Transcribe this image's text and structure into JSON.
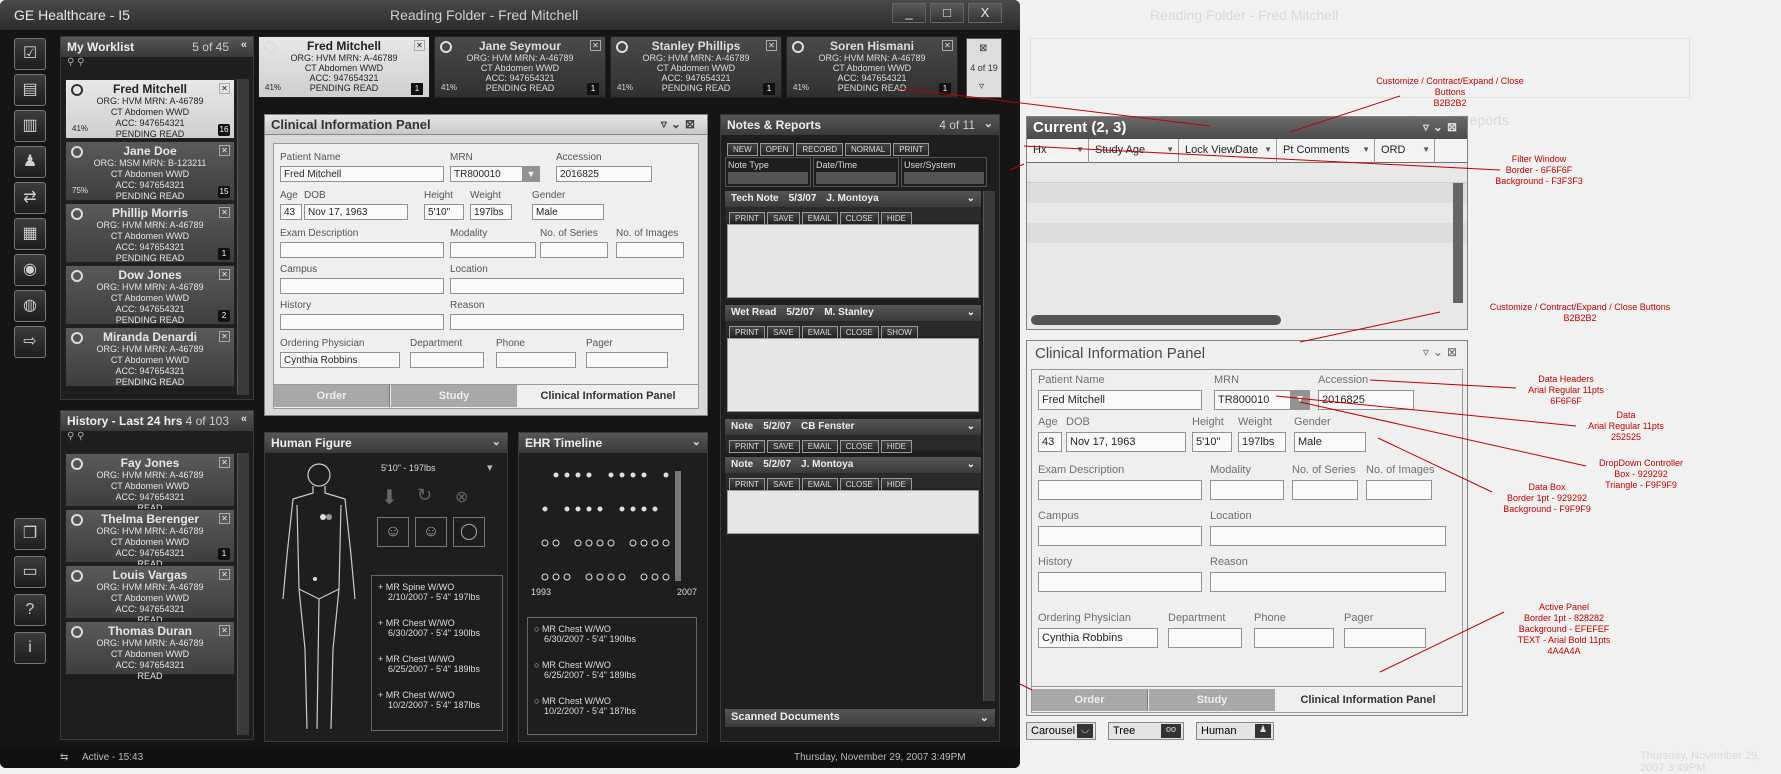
{
  "window": {
    "title": "GE Healthcare - I5",
    "center_title": "Reading Folder - Fred Mitchell",
    "btn_min": "_",
    "btn_max": "□",
    "btn_close": "X"
  },
  "sidebar_icons": [
    "clipboard-check-icon",
    "document-icon",
    "folders-icon",
    "patient-icon",
    "transfer-icon",
    "grid-icon",
    "disc-icon",
    "globe-icon",
    "logout-icon",
    "copy-icon",
    "monitor-icon",
    "help-icon",
    "info-icon"
  ],
  "worklist": {
    "title": "My Worklist",
    "count": "5 of 45",
    "items": [
      {
        "name": "Fred Mitchell",
        "org": "ORG: HVM  MRN: A-46789",
        "exam": "CT Abdomen WWD",
        "acc": "ACC: 947654321",
        "status": "PENDING READ",
        "pct": "41%",
        "badge": "16"
      },
      {
        "name": "Jane Doe",
        "org": "ORG: MSM  MRN: B-123211",
        "exam": "CT Abdomen WWD",
        "acc": "ACC: 947654321",
        "status": "PENDING READ",
        "pct": "75%",
        "badge": "15"
      },
      {
        "name": "Phillip Morris",
        "org": "ORG: HVM  MRN: A-46789",
        "exam": "CT Abdomen WWD",
        "acc": "ACC: 947654321",
        "status": "PENDING READ",
        "pct": "",
        "badge": "1"
      },
      {
        "name": "Dow Jones",
        "org": "ORG: HVM  MRN: A-46789",
        "exam": "CT Abdomen WWD",
        "acc": "ACC: 947654321",
        "status": "PENDING READ",
        "pct": "",
        "badge": "2"
      },
      {
        "name": "Miranda Denardi",
        "org": "ORG: HVM  MRN: A-46789",
        "exam": "CT Abdomen WWD",
        "acc": "ACC: 947654321",
        "status": "PENDING READ",
        "pct": "",
        "badge": ""
      }
    ]
  },
  "history": {
    "title": "History - Last 24 hrs",
    "count": "4 of 103",
    "items": [
      {
        "name": "Fay Jones",
        "org": "ORG: HVM  MRN: A-46789",
        "exam": "CT Abdomen WWD",
        "acc": "ACC: 947654321",
        "status": "READ",
        "badge": ""
      },
      {
        "name": "Thelma Berenger",
        "org": "ORG: HVM  MRN: A-46789",
        "exam": "CT Abdomen WWD",
        "acc": "ACC: 947654321",
        "status": "READ",
        "badge": "1"
      },
      {
        "name": "Louis Vargas",
        "org": "ORG: HVM  MRN: A-46789",
        "exam": "CT Abdomen WWD",
        "acc": "ACC: 947654321",
        "status": "READ",
        "badge": ""
      },
      {
        "name": "Thomas Duran",
        "org": "ORG: HVM  MRN: A-46789",
        "exam": "CT Abdomen WWD",
        "acc": "ACC: 947654321",
        "status": "READ",
        "badge": ""
      }
    ]
  },
  "tabs": [
    {
      "name": "Fred Mitchell",
      "org": "ORG: HVM  MRN: A-46789",
      "exam": "CT Abdomen WWD",
      "acc": "ACC: 947654321",
      "status": "PENDING READ",
      "pct": "41%",
      "badge": "1"
    },
    {
      "name": "Jane Seymour",
      "org": "ORG: HVM  MRN: A-46789",
      "exam": "CT Abdomen WWD",
      "acc": "ACC: 947654321",
      "status": "PENDING READ",
      "pct": "41%",
      "badge": "1"
    },
    {
      "name": "Stanley Phillips",
      "org": "ORG: HVM  MRN: A-46789",
      "exam": "CT Abdomen WWD",
      "acc": "ACC: 947654321",
      "status": "PENDING READ",
      "pct": "41%",
      "badge": "1"
    },
    {
      "name": "Soren Hismani",
      "org": "ORG: HVM  MRN: A-46789",
      "exam": "CT Abdomen WWD",
      "acc": "ACC: 947654321",
      "status": "PENDING READ",
      "pct": "41%",
      "badge": "1"
    }
  ],
  "tabs_count": "4 of 19",
  "cip": {
    "title": "Clinical Information Panel",
    "labels": {
      "patient_name": "Patient Name",
      "mrn": "MRN",
      "accession": "Accession",
      "age": "Age",
      "dob": "DOB",
      "height": "Height",
      "weight": "Weight",
      "gender": "Gender",
      "exam_desc": "Exam Description",
      "modality": "Modality",
      "series": "No. of Series",
      "images": "No. of Images",
      "campus": "Campus",
      "location": "Location",
      "history": "History",
      "reason": "Reason",
      "physician": "Ordering Physician",
      "department": "Department",
      "phone": "Phone",
      "pager": "Pager"
    },
    "values": {
      "patient_name": "Fred Mitchell",
      "mrn": "TR800010",
      "accession": "2016825",
      "age": "43",
      "dob": "Nov 17, 1963",
      "height": "5'10\"",
      "weight": "197lbs",
      "gender": "Male",
      "physician": "Cynthia Robbins"
    },
    "tabs": [
      "Order",
      "Study",
      "Clinical Information Panel"
    ]
  },
  "human": {
    "title": "Human Figure",
    "stats": "5'10\" - 197lbs",
    "list": [
      {
        "title": "MR Spine W/WO",
        "detail": "2/10/2007 - 5'4\" 197lbs"
      },
      {
        "title": "MR Chest W/WO",
        "detail": "6/30/2007 - 5'4\" 190lbs"
      },
      {
        "title": "MR Chest W/WO",
        "detail": "6/25/2007 - 5'4\" 189lbs"
      },
      {
        "title": "MR Chest W/WO",
        "detail": "10/2/2007 - 5'4\" 187lbs"
      }
    ]
  },
  "ehr": {
    "title": "EHR Timeline",
    "year_start": "1993",
    "year_end": "2007",
    "list": [
      {
        "title": "MR Chest W/WO",
        "detail": "6/30/2007 - 5'4\" 190lbs"
      },
      {
        "title": "MR Chest W/WO",
        "detail": "6/25/2007 - 5'4\" 189lbs"
      },
      {
        "title": "MR Chest W/WO",
        "detail": "10/2/2007 - 5'4\" 187lbs"
      }
    ]
  },
  "notes": {
    "title": "Notes & Reports",
    "count": "4 of 11",
    "buttons": [
      "NEW",
      "OPEN",
      "RECORD",
      "NORMAL",
      "PRINT"
    ],
    "filters": [
      "Note Type",
      "Date/Time",
      "User/System"
    ],
    "items": [
      {
        "type": "Tech Note",
        "date": "5/3/07",
        "user": "J. Montoya",
        "btns": [
          "PRINT",
          "SAVE",
          "EMAIL",
          "CLOSE",
          "HIDE"
        ]
      },
      {
        "type": "Wet Read",
        "date": "5/2/07",
        "user": "M. Stanley",
        "btns": [
          "PRINT",
          "SAVE",
          "EMAIL",
          "CLOSE",
          "SHOW"
        ]
      },
      {
        "type": "Note",
        "date": "5/2/07",
        "user": "CB Fenster",
        "btns": [
          "PRINT",
          "SAVE",
          "EMAIL",
          "CLOSE",
          "HIDE"
        ]
      },
      {
        "type": "Note",
        "date": "5/2/07",
        "user": "J. Montoya",
        "btns": [
          "PRINT",
          "SAVE",
          "EMAIL",
          "CLOSE",
          "HIDE"
        ]
      }
    ],
    "scanned": "Scanned Documents"
  },
  "status": {
    "active": "Active - 15:43",
    "datetime": "Thursday, November 29, 2007  3:49PM"
  },
  "overlay": {
    "current_title": "Current (2, 3)",
    "columns": [
      "Hx",
      "Study Age",
      "Lock ViewDate",
      "Pt Comments",
      "ORD"
    ],
    "view_buttons": [
      "Carousel",
      "Tree",
      "Human"
    ],
    "annotations": [
      {
        "text": "Customize / Contract/Expand / Close Buttons\nB2B2B2"
      },
      {
        "text": "Filter Window\nBorder - 6F6F6F\nBackground - F3F3F3"
      },
      {
        "text": "Customize / Contract/Expand / Close Buttons\nB2B2B2"
      },
      {
        "text": "Data Headers\nArial Regular 11pts\n6F6F6F"
      },
      {
        "text": "Data\nArial Regular 11pts\n252525"
      },
      {
        "text": "DropDown Controller\nBox - 929292\nTriangle - F9F9F9"
      },
      {
        "text": "Data Box\nBorder 1pt - 929292\nBackground - F9F9F9"
      },
      {
        "text": "Active Panel\nBorder 1pt - 828282\nBackground - EFEFEF\nTEXT - Arial Bold 11pts\n4A4A4A"
      }
    ]
  },
  "colors": {
    "annotation": "#c00000",
    "frame": "#151515",
    "field_border": "#929292",
    "field_bg": "#f9f9f9"
  }
}
